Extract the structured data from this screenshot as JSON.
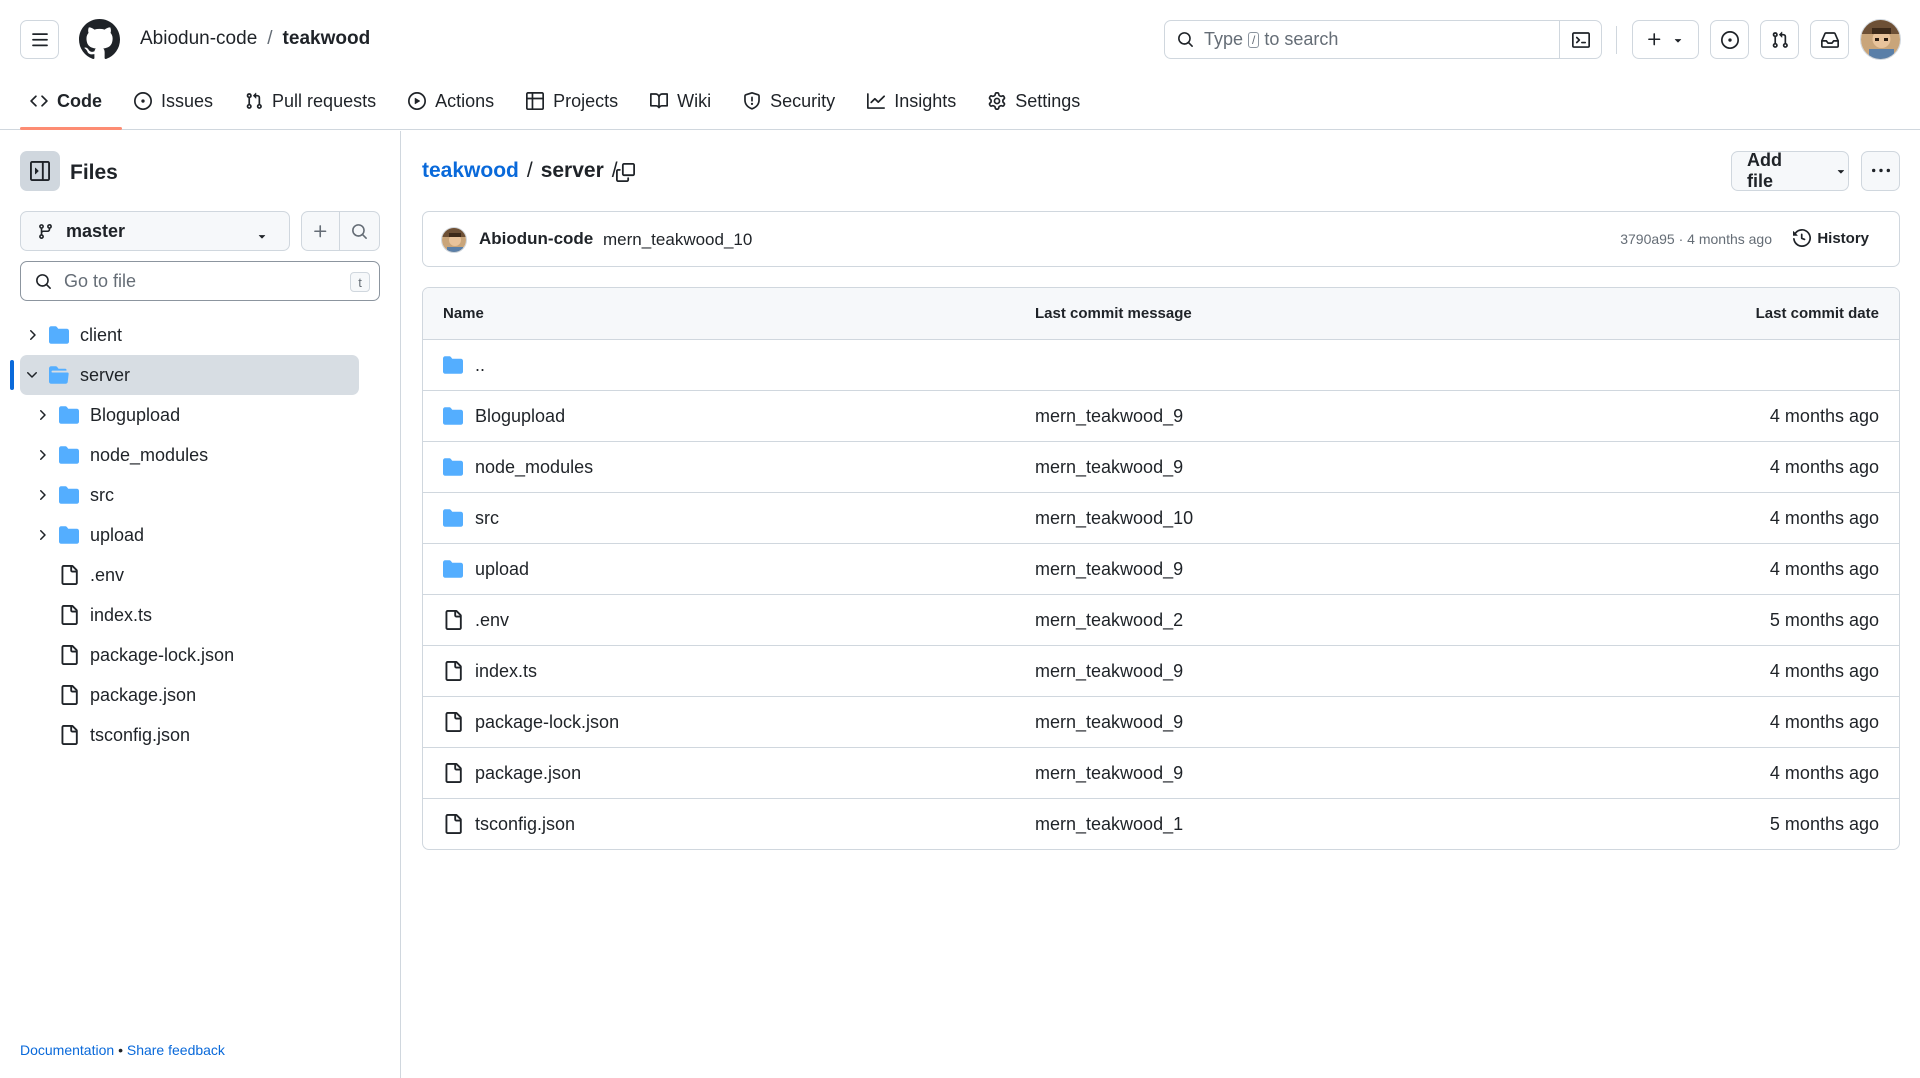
{
  "header": {
    "owner": "Abiodun-code",
    "separator": "/",
    "repo": "teakwood",
    "search_text_before": "Type",
    "search_key": "/",
    "search_text_after": "to search"
  },
  "tabs": [
    {
      "label": "Code",
      "icon": "code-icon"
    },
    {
      "label": "Issues",
      "icon": "issue-icon"
    },
    {
      "label": "Pull requests",
      "icon": "pull-request-icon"
    },
    {
      "label": "Actions",
      "icon": "play-icon"
    },
    {
      "label": "Projects",
      "icon": "table-icon"
    },
    {
      "label": "Wiki",
      "icon": "book-icon"
    },
    {
      "label": "Security",
      "icon": "shield-icon"
    },
    {
      "label": "Insights",
      "icon": "graph-icon"
    },
    {
      "label": "Settings",
      "icon": "gear-icon"
    }
  ],
  "sidebar": {
    "title": "Files",
    "branch": "master",
    "goto_placeholder": "Go to file",
    "goto_key": "t",
    "tree": [
      {
        "label": "client",
        "type": "folder",
        "level": 0,
        "expanded": false,
        "selected": false
      },
      {
        "label": "server",
        "type": "folder",
        "level": 0,
        "expanded": true,
        "selected": true
      },
      {
        "label": "Blogupload",
        "type": "folder",
        "level": 1,
        "expanded": false,
        "selected": false
      },
      {
        "label": "node_modules",
        "type": "folder",
        "level": 1,
        "expanded": false,
        "selected": false
      },
      {
        "label": "src",
        "type": "folder",
        "level": 1,
        "expanded": false,
        "selected": false
      },
      {
        "label": "upload",
        "type": "folder",
        "level": 1,
        "expanded": false,
        "selected": false
      },
      {
        "label": ".env",
        "type": "file",
        "level": 1,
        "selected": false
      },
      {
        "label": "index.ts",
        "type": "file",
        "level": 1,
        "selected": false
      },
      {
        "label": "package-lock.json",
        "type": "file",
        "level": 1,
        "selected": false
      },
      {
        "label": "package.json",
        "type": "file",
        "level": 1,
        "selected": false
      },
      {
        "label": "tsconfig.json",
        "type": "file",
        "level": 1,
        "selected": false
      }
    ],
    "footer_docs": "Documentation",
    "footer_bullet": "•",
    "footer_feedback": "Share feedback"
  },
  "main": {
    "breadcrumb_repo": "teakwood",
    "breadcrumb_sep": "/",
    "breadcrumb_dir": "server",
    "breadcrumb_trailing": "/",
    "add_file_label": "Add file",
    "commit": {
      "author": "Abiodun-code",
      "message": "mern_teakwood_10",
      "meta": "3790a95 · 4 months ago",
      "history_label": "History"
    },
    "table_headers": {
      "name": "Name",
      "message": "Last commit message",
      "date": "Last commit date"
    },
    "parent_dir": "..",
    "rows": [
      {
        "name": "Blogupload",
        "type": "folder",
        "message": "mern_teakwood_9",
        "date": "4 months ago"
      },
      {
        "name": "node_modules",
        "type": "folder",
        "message": "mern_teakwood_9",
        "date": "4 months ago"
      },
      {
        "name": "src",
        "type": "folder",
        "message": "mern_teakwood_10",
        "date": "4 months ago"
      },
      {
        "name": "upload",
        "type": "folder",
        "message": "mern_teakwood_9",
        "date": "4 months ago"
      },
      {
        "name": ".env",
        "type": "file",
        "message": "mern_teakwood_2",
        "date": "5 months ago"
      },
      {
        "name": "index.ts",
        "type": "file",
        "message": "mern_teakwood_9",
        "date": "4 months ago"
      },
      {
        "name": "package-lock.json",
        "type": "file",
        "message": "mern_teakwood_9",
        "date": "4 months ago"
      },
      {
        "name": "package.json",
        "type": "file",
        "message": "mern_teakwood_9",
        "date": "4 months ago"
      },
      {
        "name": "tsconfig.json",
        "type": "file",
        "message": "mern_teakwood_1",
        "date": "5 months ago"
      }
    ]
  },
  "colors": {
    "accent_link": "#0969da",
    "folder": "#54aeff",
    "selected_tab_underline": "#fd8c73",
    "border": "#d0d7de"
  }
}
